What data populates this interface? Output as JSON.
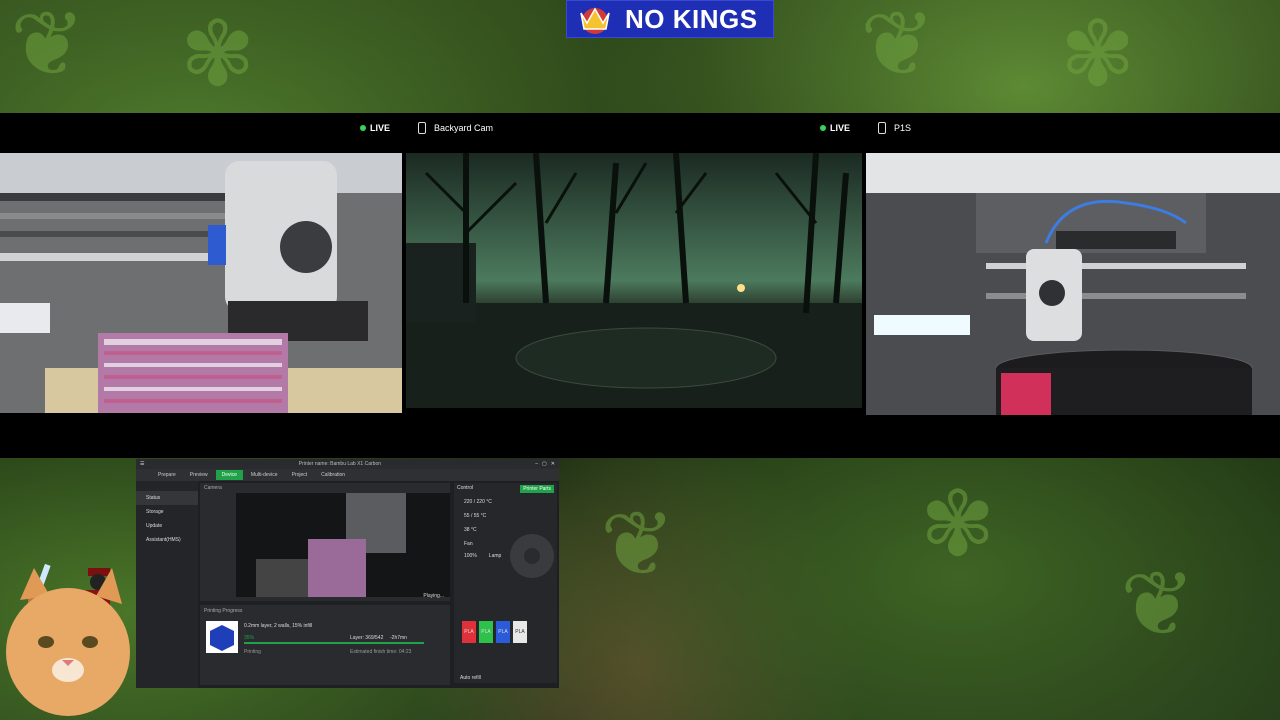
{
  "banner": {
    "text": "NO KINGS"
  },
  "cams": [
    {
      "name": "",
      "live": "LIVE"
    },
    {
      "name": "Backyard Cam",
      "live": "LIVE"
    },
    {
      "name": "P1S",
      "live": ""
    }
  ],
  "app": {
    "title": "Printer name: Bambu Lab X1 Carbon",
    "tabs": [
      "Prepare",
      "Preview",
      "Device",
      "Multi-device",
      "Project",
      "Calibration"
    ],
    "active_tab": "Device",
    "sidebar": [
      "Status",
      "Storage",
      "Update",
      "Assistant(HMS)"
    ],
    "camera_label": "Camera",
    "control_label": "Control",
    "printer_parts_button": "Printer Parts",
    "playing_label": "Playing...",
    "printing_progress_label": "Printing Progress",
    "job_name": "0.2mm layer, 2 walls, 15% infill",
    "progress_percent": "35%",
    "layer_text": "Layer: 369/542",
    "time_left": "-2h7mn",
    "status_text": "Printing",
    "finish_text": "Estimated finish time: 04:23",
    "nozzle_temp": "220 / 220 °C",
    "bed_temp": "55 / 55 °C",
    "chamber_temp": "38 °C",
    "fan_label": "Fan",
    "lamp_label": "Lamp",
    "speed": "100%",
    "auto_refill": "Auto refill",
    "ams_slots": [
      {
        "label": "PLA",
        "color": "#e0303a"
      },
      {
        "label": "PLA",
        "color": "#2ec24a"
      },
      {
        "label": "PLA",
        "color": "#2b5bd8"
      },
      {
        "label": "PLA",
        "color": "#e8e8e8"
      }
    ]
  }
}
